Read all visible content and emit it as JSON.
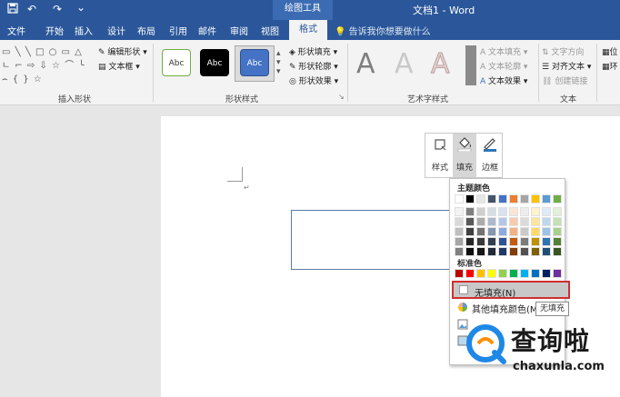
{
  "titlebar": {
    "quick_save_icon": "save-icon",
    "undo_glyph": "↶",
    "redo_glyph": "↷",
    "customize_glyph": "⌄",
    "context_group": "绘图工具",
    "document_title": "文档1 - Word"
  },
  "tabs": [
    {
      "label": "文件"
    },
    {
      "label": "开始"
    },
    {
      "label": "插入"
    },
    {
      "label": "设计"
    },
    {
      "label": "布局"
    },
    {
      "label": "引用"
    },
    {
      "label": "邮件"
    },
    {
      "label": "审阅"
    },
    {
      "label": "视图"
    }
  ],
  "active_tab": "格式",
  "tellme": "告诉我你想要做什么",
  "ribbon": {
    "insert_shapes": {
      "label": "插入形状",
      "shape_glyphs": "▭ ╲ ╲ □ ○ ▭ △ ㄴ ⌐ ⇨ ⇩ ☆ ⌒ ╰ ⌢ { } ☆",
      "edit_shape": "编辑形状",
      "textbox": "文本框"
    },
    "shape_styles": {
      "label": "形状样式",
      "presets": [
        {
          "text": "Abc"
        },
        {
          "text": "Abc"
        },
        {
          "text": "Abc"
        }
      ],
      "fill": "形状填充",
      "outline": "形状轮廓",
      "effects": "形状效果"
    },
    "wordart": {
      "label": "艺术字样式",
      "letters": [
        "A",
        "A",
        "A"
      ],
      "text_fill": "文本填充",
      "text_outline": "文本轮廓",
      "text_effects": "文本效果"
    },
    "text": {
      "label": "文本",
      "direction": "文字方向",
      "align": "对齐文本",
      "link": "创建链接"
    },
    "overflow": {
      "position": "位",
      "wrap": "环"
    }
  },
  "minitoolbar": {
    "style": "样式",
    "fill": "填充",
    "border": "边框"
  },
  "dropdown": {
    "theme_colors_heading": "主题颜色",
    "theme_top_row": [
      "#ffffff",
      "#000000",
      "#e7e6e6",
      "#44546a",
      "#4472c4",
      "#ed7d31",
      "#a5a5a5",
      "#ffc000",
      "#5b9bd5",
      "#70ad47"
    ],
    "theme_columns": [
      [
        "#f2f2f2",
        "#d9d9d9",
        "#bfbfbf",
        "#a6a6a6",
        "#808080"
      ],
      [
        "#7f7f7f",
        "#595959",
        "#404040",
        "#262626",
        "#0d0d0d"
      ],
      [
        "#d0cece",
        "#aeaaaa",
        "#757171",
        "#3a3838",
        "#171616"
      ],
      [
        "#d6dce4",
        "#adb9ca",
        "#8497b0",
        "#333f4f",
        "#222a35"
      ],
      [
        "#d9e2f3",
        "#b4c6e7",
        "#8eaadb",
        "#2f5496",
        "#1f3864"
      ],
      [
        "#fbe5d5",
        "#f7cbac",
        "#f4b183",
        "#c55a11",
        "#843c0b"
      ],
      [
        "#ededed",
        "#dbdbdb",
        "#c9c9c9",
        "#7b7b7b",
        "#525252"
      ],
      [
        "#fff2cc",
        "#fee599",
        "#ffd966",
        "#bf9000",
        "#7f6000"
      ],
      [
        "#deebf6",
        "#bdd7ee",
        "#9dc3e6",
        "#2e75b5",
        "#1f4e79"
      ],
      [
        "#e2efd9",
        "#c5e0b3",
        "#a8d08d",
        "#538135",
        "#375623"
      ]
    ],
    "standard_heading": "标准色",
    "standard_colors": [
      "#c00000",
      "#ff0000",
      "#ffc000",
      "#ffff00",
      "#92d050",
      "#00b050",
      "#00b0f0",
      "#0070c0",
      "#002060",
      "#7030a0"
    ],
    "no_fill": "无填充(N)",
    "more_colors": "其他填充颜色(M)..."
  },
  "tooltip": "无填充",
  "watermark": {
    "brand": "查询啦",
    "url": "chaxunla.com"
  },
  "colors": {
    "word_blue": "#2b579a",
    "highlight_red": "#d12f2f"
  }
}
